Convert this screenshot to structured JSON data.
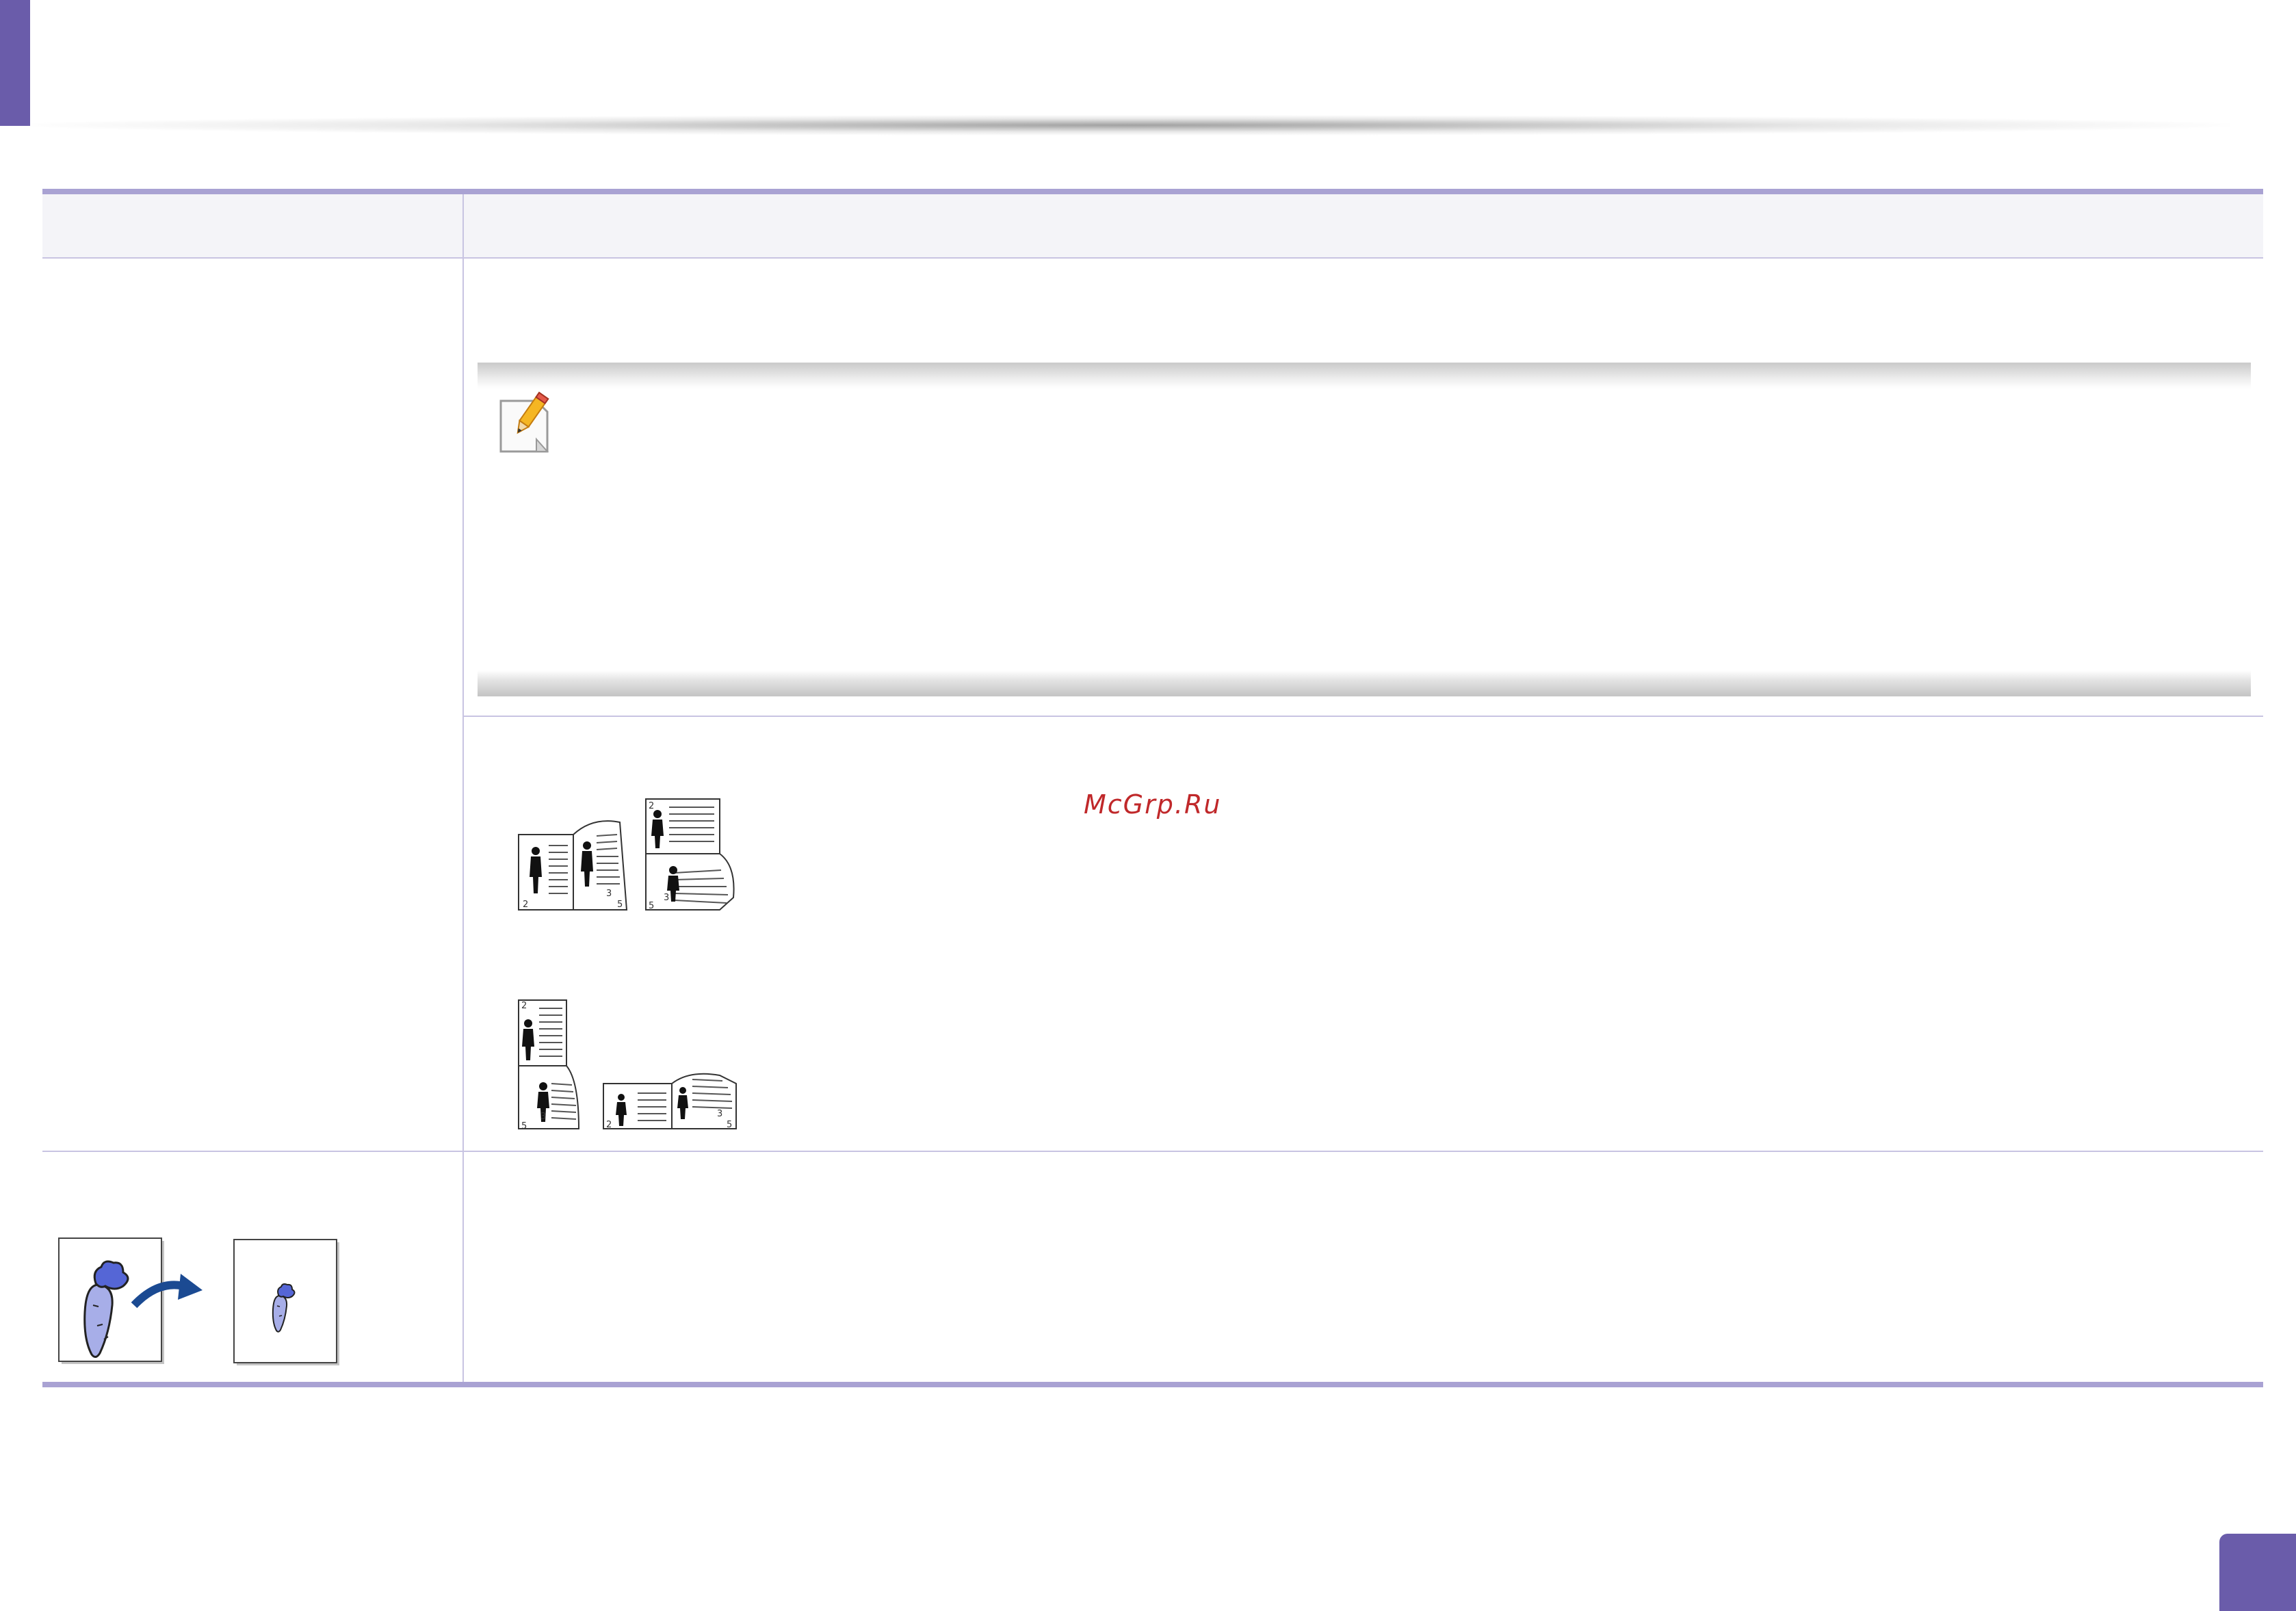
{
  "watermark": {
    "text": "McGrp.Ru"
  },
  "colors": {
    "accent": "#6a5caa",
    "table_rule": "#a9a2d3",
    "header_fill": "#f4f4f8",
    "watermark": "#c0282a"
  },
  "icons": {
    "note": "note-pencil-icon",
    "binding_long_edge": "long-edge-binding-icon",
    "binding_short_edge": "short-edge-binding-icon",
    "reduce": "reduce-enlarge-icon"
  }
}
